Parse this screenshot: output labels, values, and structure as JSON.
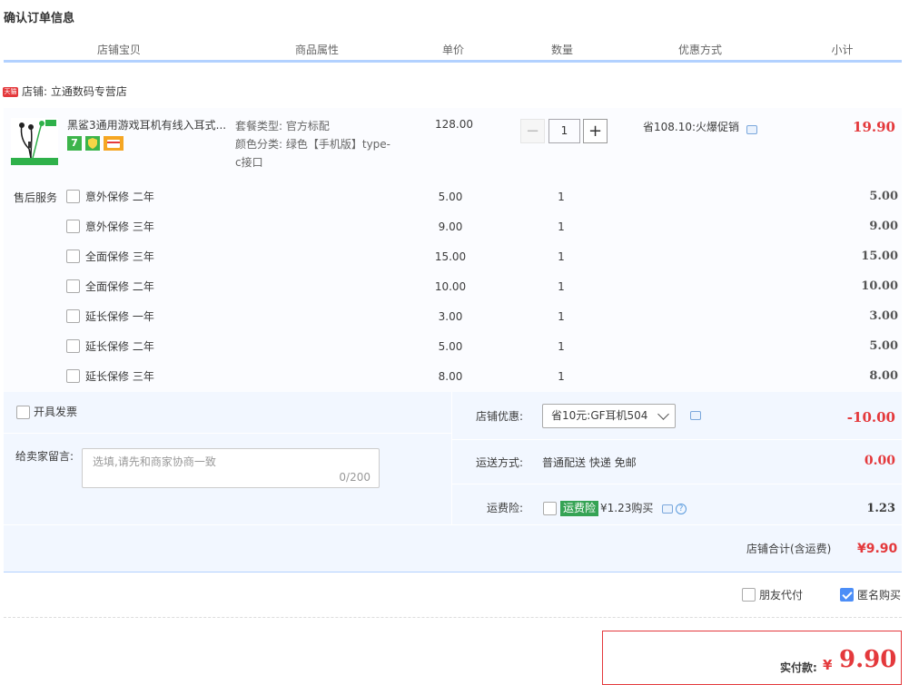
{
  "page_title": "确认订单信息",
  "columns": [
    "店铺宝贝",
    "商品属性",
    "单价",
    "数量",
    "优惠方式",
    "小计"
  ],
  "shop": {
    "tag": "天猫",
    "label": "店铺: 立通数码专营店"
  },
  "product": {
    "name": "黑鲨3通用游戏耳机有线入耳式...",
    "badges": [
      "7"
    ],
    "attrs": [
      "套餐类型:  官方标配",
      "颜色分类:  绿色【手机版】type-",
      "c接口"
    ],
    "price": "128.00",
    "quantity": "1",
    "minus": "−",
    "plus": "+",
    "promo": "省108.10:火爆促销",
    "subtotal": "19.90"
  },
  "after_sales": {
    "label": "售后服务",
    "items": [
      {
        "name": "意外保修 二年",
        "price": "5.00",
        "qty": "1",
        "subtotal": "5.00"
      },
      {
        "name": "意外保修 三年",
        "price": "9.00",
        "qty": "1",
        "subtotal": "9.00"
      },
      {
        "name": "全面保修 三年",
        "price": "15.00",
        "qty": "1",
        "subtotal": "15.00"
      },
      {
        "name": "全面保修 二年",
        "price": "10.00",
        "qty": "1",
        "subtotal": "10.00"
      },
      {
        "name": "延长保修 一年",
        "price": "3.00",
        "qty": "1",
        "subtotal": "3.00"
      },
      {
        "name": "延长保修 二年",
        "price": "5.00",
        "qty": "1",
        "subtotal": "5.00"
      },
      {
        "name": "延长保修 三年",
        "price": "8.00",
        "qty": "1",
        "subtotal": "8.00"
      }
    ]
  },
  "invoice_label": "开具发票",
  "memo": {
    "label": "给卖家留言:",
    "placeholder": "选填,请先和商家协商一致",
    "counter": "0/200"
  },
  "shop_discount": {
    "label": "店铺优惠:",
    "selected": "省10元:GF耳机504",
    "value": "-10.00"
  },
  "shipping": {
    "label": "运送方式:",
    "value": "普通配送 快递 免邮",
    "cost": "0.00"
  },
  "insurance": {
    "label": "运费险:",
    "tag": "运费险",
    "desc": "¥1.23购买",
    "help": "?",
    "cost": "1.23"
  },
  "shop_total": {
    "label": "店铺合计(含运费)",
    "value": "¥9.90"
  },
  "options": {
    "friend_pay": "朋友代付",
    "anonymous": "匿名购买"
  },
  "payment": {
    "label": "实付款:",
    "currency": "¥",
    "value": "9.90"
  },
  "colors": {
    "accent_red": "#e4393c",
    "header_line": "#b2d1ff",
    "panel_bg": "#f2f7ff",
    "tag_green": "#35a354",
    "check_blue": "#4c8ef7"
  }
}
